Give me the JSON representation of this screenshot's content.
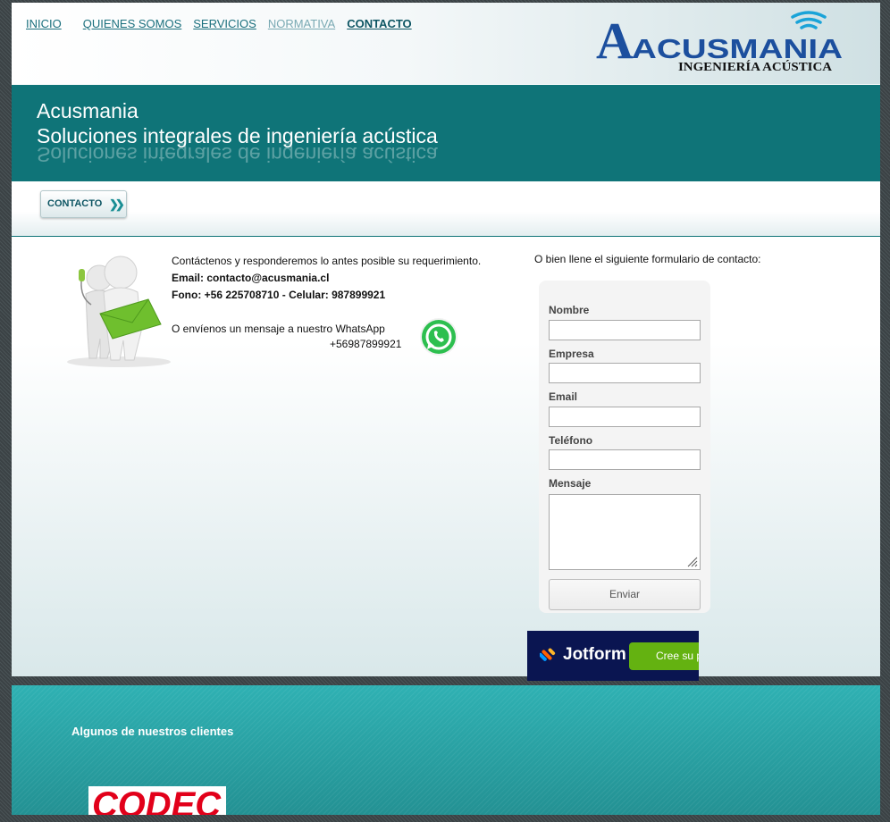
{
  "nav": {
    "items": [
      {
        "label": "INICIO"
      },
      {
        "label": "QUIENES SOMOS"
      },
      {
        "label": "SERVICIOS"
      },
      {
        "label": "NORMATIVA"
      },
      {
        "label": "CONTACTO"
      }
    ]
  },
  "logo": {
    "wordmark": "ACUSMANIA",
    "tagline": "INGENIERÍA ACÚSTICA"
  },
  "banner": {
    "title": "Acusmania",
    "subtitle": "Soluciones integrales de ingeniería acústica"
  },
  "breadcrumb": {
    "label": "CONTACTO"
  },
  "contact": {
    "intro": "Contáctenos y responderemos lo antes posible su requerimiento.",
    "email": "Email: contacto@acusmania.cl",
    "phone": "Fono: +56 225708710 - Celular: 987899921",
    "whatsapp_text": "O envíenos un mensaje a nuestro WhatsApp",
    "whatsapp_number": "+56987899921"
  },
  "form": {
    "intro": "O bien llene el siguiente formulario de contacto:",
    "fields": [
      {
        "label": "Nombre",
        "value": ""
      },
      {
        "label": "Empresa",
        "value": ""
      },
      {
        "label": "Email",
        "value": ""
      },
      {
        "label": "Teléfono",
        "value": ""
      },
      {
        "label": "Mensaje",
        "value": ""
      }
    ],
    "submit_label": "Enviar"
  },
  "jotform": {
    "brand": "Jotform",
    "cta": "Cree su p"
  },
  "footer": {
    "title": "Algunos de nuestros clientes",
    "client_logo": "CODEC"
  },
  "colors": {
    "accent": "#0f7478",
    "nav_link": "#1a6f7d",
    "footer": "#2ba6a8",
    "jotform_bg": "#0a1551",
    "jotform_cta": "#64b211"
  },
  "icons": [
    "wifi-signal-icon",
    "support-figure-icon",
    "whatsapp-icon",
    "double-chevron-icon",
    "jotform-logo-icon",
    "resize-grip-icon"
  ]
}
